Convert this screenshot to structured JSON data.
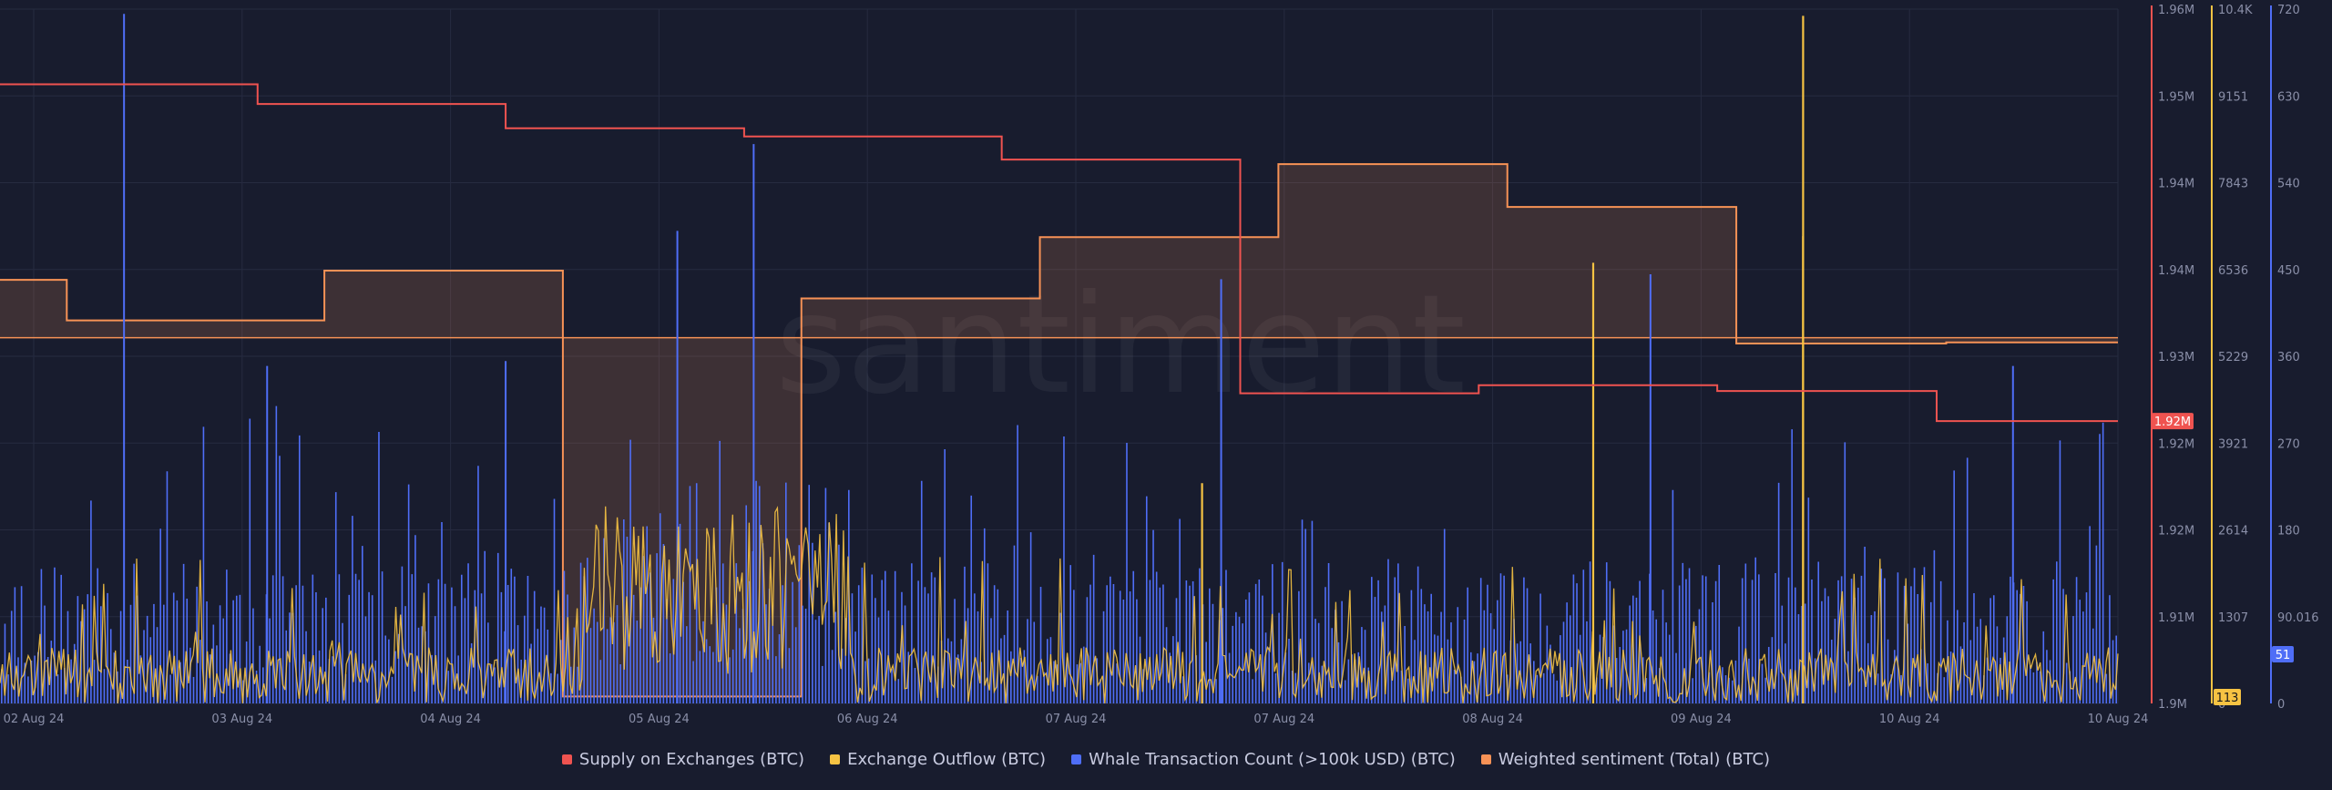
{
  "chart_data": {
    "type": "line",
    "watermark": "santiment",
    "x_ticks": [
      "02 Aug 24",
      "03 Aug 24",
      "04 Aug 24",
      "05 Aug 24",
      "06 Aug 24",
      "07 Aug 24",
      "07 Aug 24",
      "08 Aug 24",
      "09 Aug 24",
      "10 Aug 24",
      "10 Aug 24"
    ],
    "grid": true,
    "axes": {
      "supply": {
        "ticks": [
          "1.96M",
          "1.95M",
          "1.94M",
          "1.94M",
          "1.93M",
          "1.92M",
          "1.92M",
          "1.91M",
          "1.9M"
        ],
        "range": [
          1.9,
          1.96
        ],
        "current_label": "1.92M",
        "current_value": 1.9244,
        "color": "#ef5350"
      },
      "outflow": {
        "ticks": [
          "10.4K",
          "9151",
          "7843",
          "6536",
          "5229",
          "3921",
          "2614",
          "1307",
          "0"
        ],
        "range": [
          0,
          10400
        ],
        "current_label": "113",
        "current_value": 113,
        "color": "#f6c343"
      },
      "whale": {
        "ticks": [
          "720",
          "630",
          "540",
          "450",
          "360",
          "270",
          "180",
          "90.016",
          "0"
        ],
        "range": [
          0,
          720
        ],
        "current_label": "51",
        "current_value": 51,
        "color": "#4f6ef7"
      }
    },
    "series": [
      {
        "name": "Supply on Exchanges (BTC)",
        "color": "#ef5350",
        "axis": "supply",
        "x_days": [
          0,
          1.35,
          1.35,
          2.65,
          2.65,
          3.9,
          3.9,
          5.25,
          5.25,
          6.5,
          6.5,
          7.75,
          7.75,
          9.0,
          9.0,
          10.15,
          10.15,
          11.1
        ],
        "y": [
          1.9535,
          1.9535,
          1.9518,
          1.9518,
          1.9497,
          1.9497,
          1.949,
          1.949,
          1.947,
          1.947,
          1.9268,
          1.9268,
          1.9275,
          1.9275,
          1.927,
          1.927,
          1.9244,
          1.9244
        ]
      },
      {
        "name": "Weighted sentiment (Total) (BTC)",
        "color": "#f79256",
        "axis": "sentiment",
        "baseline": 1.9316,
        "x_days": [
          0,
          0.35,
          0.35,
          1.7,
          1.7,
          2.95,
          2.95,
          4.2,
          4.2,
          5.45,
          5.45,
          6.7,
          6.7,
          7.9,
          7.9,
          9.1,
          9.1,
          10.2,
          10.2,
          11.1
        ],
        "y": [
          1.9366,
          1.9366,
          1.9331,
          1.9331,
          1.9374,
          1.9374,
          1.9006,
          1.9006,
          1.935,
          1.935,
          1.9403,
          1.9403,
          1.9466,
          1.9466,
          1.9429,
          1.9429,
          1.9311,
          1.9311,
          1.9312,
          1.9312
        ]
      },
      {
        "name": "Exchange Outflow (BTC)",
        "color": "#f6c343",
        "axis": "outflow",
        "spikes": [
          {
            "x_days": 8.35,
            "value": 6600
          },
          {
            "x_days": 9.45,
            "value": 10300
          },
          {
            "x_days": 9.45,
            "value": 7000
          },
          {
            "x_days": 6.3,
            "value": 3300
          }
        ],
        "base_level": 600
      },
      {
        "name": "Whale Transaction Count (>100k USD) (BTC)",
        "color": "#4f6ef7",
        "axis": "whale",
        "spikes": [
          {
            "x_days": 0.65,
            "value": 715
          },
          {
            "x_days": 3.95,
            "value": 580
          },
          {
            "x_days": 3.55,
            "value": 490
          },
          {
            "x_days": 1.4,
            "value": 350
          },
          {
            "x_days": 2.65,
            "value": 355
          },
          {
            "x_days": 10.55,
            "value": 350
          },
          {
            "x_days": 8.65,
            "value": 445
          },
          {
            "x_days": 6.4,
            "value": 440
          }
        ],
        "base_level": 95
      }
    ],
    "legend": {
      "placement": "bottom",
      "items": [
        {
          "label": "Supply on Exchanges (BTC)",
          "color": "#ef5350"
        },
        {
          "label": "Exchange Outflow (BTC)",
          "color": "#f6c343"
        },
        {
          "label": "Whale Transaction Count (>100k USD) (BTC)",
          "color": "#4f6ef7"
        },
        {
          "label": "Weighted sentiment (Total) (BTC)",
          "color": "#f79256"
        }
      ]
    }
  }
}
